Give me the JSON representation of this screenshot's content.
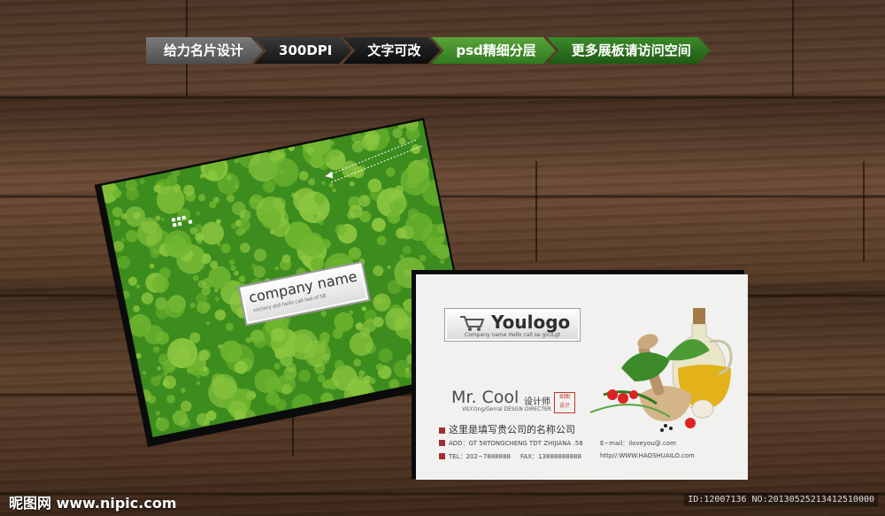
{
  "banner": [
    "给力名片设计",
    "300DPI",
    "文字可改",
    "psd精细分层",
    "更多展板请访问空间"
  ],
  "green_card": {
    "company_name": "company name",
    "company_sub": "coctory atd hello call.ted.of.58"
  },
  "white_card": {
    "logo": "Youlogo",
    "logo_sub": "Company name Hello call se gicd,gt",
    "name": "Mr. Cool",
    "role": "设计师",
    "seal": "如图\n设计",
    "subtitle": "VILY.Ong/Gerral DESGN DIRECTER",
    "company": "这里是填写贵公司的名称公司",
    "add": "ADD：GT 58TONGCHENG TDT ZHIJIANA .58",
    "tel": "TEL：202−7888888",
    "fax": "FAX：13888888888",
    "email": "E−mail：iloveyou@.com",
    "web": "http//:WWW.HAOSHUAILO.com"
  },
  "watermark": "昵图网 www.nipic.com",
  "image_id": "ID:12007136 NO:20130525213412510000",
  "colors": {
    "green": "#3d8c1e",
    "light_green": "#8cc63f",
    "card_white": "#f1f1f0"
  }
}
